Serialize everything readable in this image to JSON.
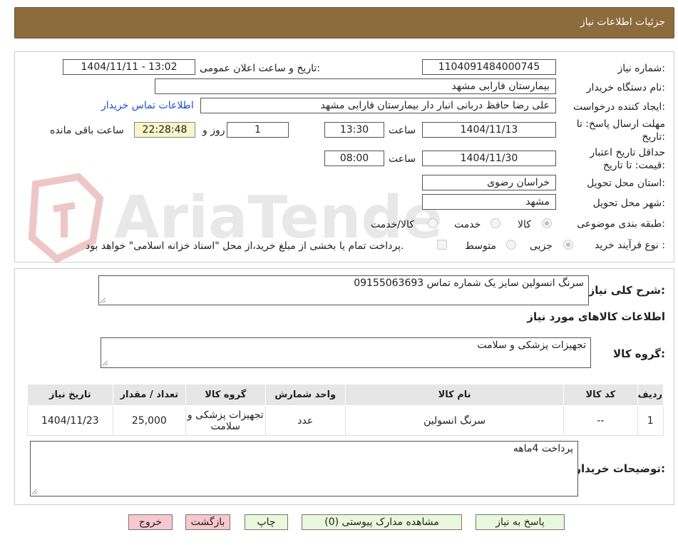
{
  "header": {
    "title": "جزئیات اطلاعات نیاز"
  },
  "watermark": {
    "text": "AriaTender.neT"
  },
  "form": {
    "need_number_label": "شماره نیاز:",
    "need_number": "1104091484000745",
    "announce_label": "تاریخ و ساعت اعلان عمومی:",
    "announce_value": "1404/11/11 - 13:02",
    "buyer_org_label": "نام دستگاه خریدار:",
    "buyer_org": "بیمارستان فارابی مشهد",
    "creator_label": "ایجاد کننده درخواست:",
    "creator": "علی رضا حافظ دربانی انبار دار بیمارستان فارابی مشهد",
    "contact_link": "اطلاعات تماس خریدار",
    "reply_deadline_label_1": "مهلت ارسال پاسخ: تا",
    "reply_deadline_label_2": "تاریخ:",
    "reply_date": "1404/11/13",
    "time_label": "ساعت",
    "reply_time": "13:30",
    "days_value": "1",
    "days_label": "روز و",
    "remaining_time": "22:28:48",
    "remaining_label": "ساعت باقی مانده",
    "validity_label_1": "حداقل تاریخ اعتبار",
    "validity_label_2": "قیمت: تا تاریخ:",
    "validity_date": "1404/11/30",
    "validity_time": "08:00",
    "province_label": "استان محل تحویل:",
    "province": "خراسان رضوی",
    "city_label": "شهر محل تحویل:",
    "city": "مشهد",
    "category_label": "طبقه بندی موضوعی:",
    "category_options": [
      "کالا",
      "خدمت",
      "کالا/خدمت"
    ],
    "category_selected": "کالا",
    "process_label": "نوع فرآیند خرید :",
    "process_options": [
      "جزیی",
      "متوسط"
    ],
    "process_selected": "جزیی",
    "treasury_note": "پرداخت تمام یا بخشی از مبلغ خرید،از محل \"اسناد خزانه اسلامی\" خواهد بود."
  },
  "details": {
    "summary_label": "شرح کلی نیاز:",
    "summary": "سرنگ انسولین سایز یک شماره تماس 09155063693",
    "goods_title": "اطلاعات کالاهای مورد نیاز",
    "group_label": "گروه کالا:",
    "group": "تجهیزات پزشکی و سلامت",
    "table": {
      "headers": [
        "ردیف",
        "کد کالا",
        "نام کالا",
        "واحد شمارش",
        "گروه کالا",
        "تعداد / مقدار",
        "تاریخ نیاز"
      ],
      "rows": [
        [
          "1",
          "--",
          "سرنگ انسولین",
          "عدد",
          "تجهیزات پزشکی و سلامت",
          "25,000",
          "1404/11/23"
        ]
      ]
    },
    "buyer_notes_label": "توضیحات خریدار:",
    "buyer_notes": "پرداخت 4ماهه"
  },
  "buttons": {
    "reply": "پاسخ به نیاز",
    "attachments": "مشاهده مدارک پیوستی (0)",
    "print": "چاپ",
    "back": "بازگشت",
    "exit": "خروج"
  }
}
